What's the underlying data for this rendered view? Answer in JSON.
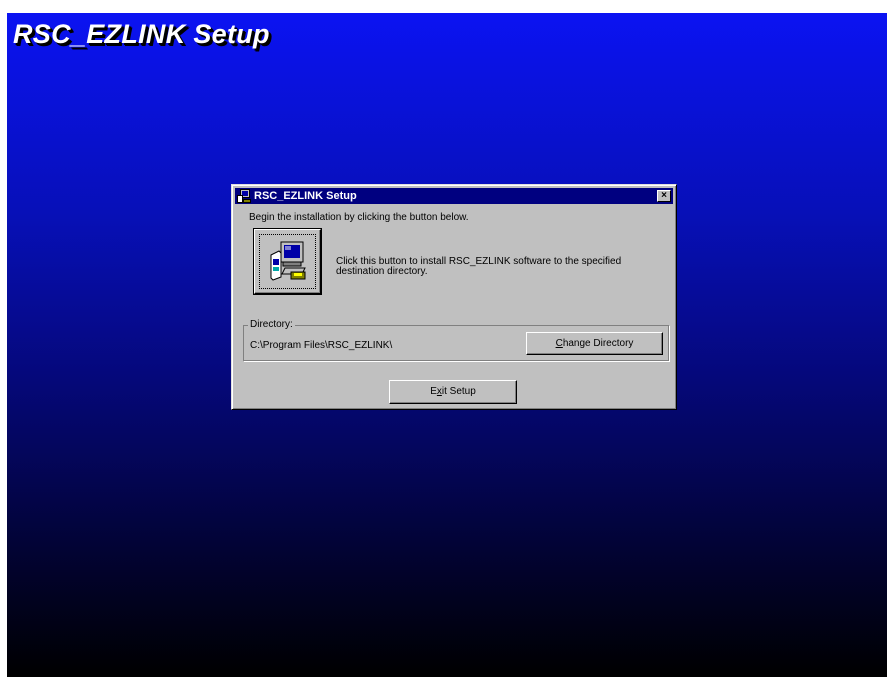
{
  "screen": {
    "title": "RSC_EZLINK Setup",
    "background_top": "#0b13f2",
    "background_bottom": "#000000"
  },
  "dialog": {
    "title": "RSC_EZLINK Setup",
    "close_glyph": "×",
    "intro": "Begin the installation by clicking the button below.",
    "install_icon": "computer-setup-icon",
    "install_description": "Click this button to install RSC_EZLINK software to the specified destination directory.",
    "directory_label": "Directory:",
    "directory_path": "C:\\Program Files\\RSC_EZLINK\\",
    "change_directory_prefix": "",
    "change_directory_accel": "C",
    "change_directory_rest": "hange Directory",
    "exit_prefix": "E",
    "exit_accel": "x",
    "exit_rest": "it Setup",
    "titlebar_color": "#000080",
    "face_color": "#c0c0c0"
  }
}
